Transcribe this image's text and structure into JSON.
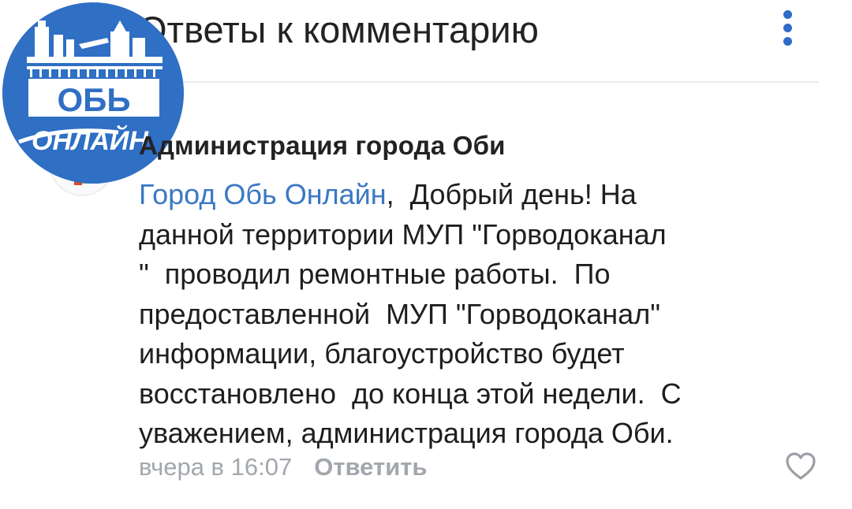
{
  "header": {
    "title": "Ответы к комментарию"
  },
  "logo": {
    "brand_top": "ОБЬ",
    "brand_bottom": "ОНЛАЙН"
  },
  "comment": {
    "author": "Администрация города Оби",
    "mention": "Город Обь Онлайн",
    "line1_rest": ",  Добрый день! На",
    "line2": "данной территории МУП \"Горводоканал",
    "line3": "\"  проводил ремонтные работы.  По",
    "line4": "предоставленной  МУП \"Горводоканал\"",
    "line5": "информации, благоустройство будет",
    "line6": "восстановлено  до конца этой недели.  С",
    "line7": "уважением, администрация города Оби.",
    "time": "вчера в 16:07",
    "reply_label": "Ответить"
  },
  "colors": {
    "accent": "#2e6cc6",
    "mention": "#3a78c4",
    "logo_bg": "#2f6fc4",
    "meta": "#a2a7ad"
  },
  "icons": [
    "back-arrow-icon",
    "more-vertical-icon",
    "heart-icon"
  ]
}
